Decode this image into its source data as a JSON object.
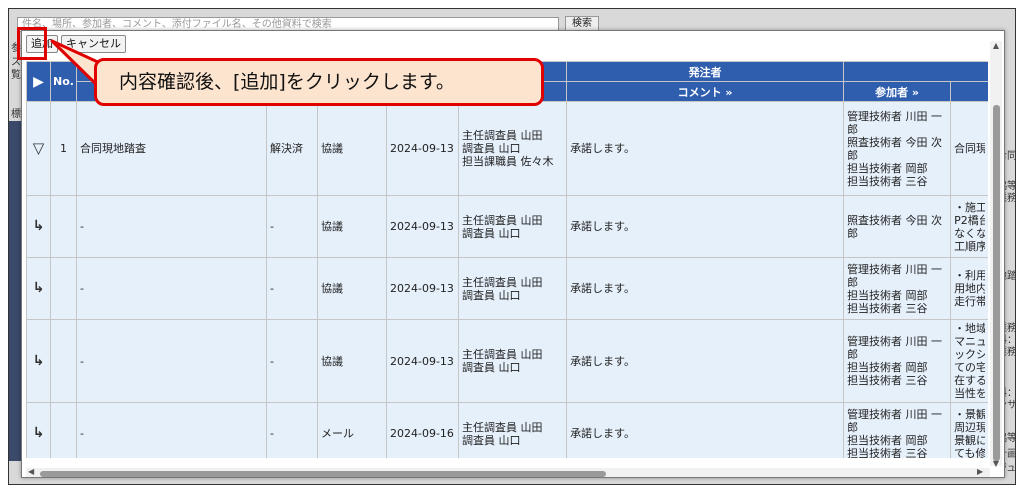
{
  "background": {
    "search_placeholder": "件名、場所、参加者、コメント、添付ファイル名、その他資料で検索",
    "search_button": "検索",
    "side_fragments": [
      "参",
      "ス",
      "覧",
      "標"
    ],
    "right_fragments": [
      "合同現",
      "協等共",
      "業務",
      "地踏査",
      "業務",
      "料：第",
      "業務",
      "料：自",
      "ンサル",
      "協等共",
      "計画",
      "ジュー"
    ]
  },
  "toolbar": {
    "add_label": "追加",
    "cancel_label": "キャンセル"
  },
  "callout": {
    "text": "内容確認後、[追加]をクリックします。"
  },
  "table": {
    "header_no": "No.",
    "header_client": "発注者",
    "header_comment": "コメント",
    "header_participants": "参加者",
    "link_arrow": "»",
    "rows": [
      {
        "toggle": "▽",
        "no": "1",
        "subject": "合同現地踏査",
        "status": "解決済",
        "type": "協議",
        "date": "2024-09-13",
        "client_attendees": [
          "主任調査員 山田",
          "調査員 山口",
          "担当課職員 佐々木"
        ],
        "comment": "承諾します。",
        "participants": [
          "管理技術者 川田 一",
          "郎",
          "照査技術者 今田 次",
          "郎",
          "担当技術者 岡部",
          "担当技術者 三谷"
        ],
        "detail": [
          "合同現"
        ]
      },
      {
        "toggle": "↳",
        "no": "",
        "subject": "-",
        "status": "-",
        "type": "協議",
        "date": "2024-09-13",
        "client_attendees": [
          "主任調査員 山田",
          "調査員 山口"
        ],
        "comment": "承諾します。",
        "participants": [
          "照査技術者 今田 次",
          "郎"
        ],
        "detail": [
          "・施工",
          "P2橋台",
          "なくな",
          "工順序"
        ]
      },
      {
        "toggle": "↳",
        "no": "",
        "subject": "-",
        "status": "-",
        "type": "協議",
        "date": "2024-09-13",
        "client_attendees": [
          "主任調査員 山田",
          "調査員 山口"
        ],
        "comment": "承諾します。",
        "participants": [
          "管理技術者 川田 一",
          "郎",
          "担当技術者 岡部",
          "担当技術者 三谷"
        ],
        "detail": [
          "・利用",
          "用地内",
          "走行帯"
        ]
      },
      {
        "toggle": "↳",
        "no": "",
        "subject": "-",
        "status": "-",
        "type": "協議",
        "date": "2024-09-13",
        "client_attendees": [
          "主任調査員 山田",
          "調査員 山口"
        ],
        "comment": "承諾します。",
        "participants": [
          "管理技術者 川田 一",
          "郎",
          "担当技術者 岡部",
          "担当技術者 三谷"
        ],
        "detail": [
          "・地域",
          "マニュア",
          "ックシ",
          "ての宅",
          "在する",
          "当性を"
        ]
      },
      {
        "toggle": "↳",
        "no": "",
        "subject": "-",
        "status": "-",
        "type": "メール",
        "date": "2024-09-16",
        "client_attendees": [
          "主任調査員 山田",
          "調査員 山口"
        ],
        "comment": "承諾します。",
        "participants": [
          "管理技術者 川田 一",
          "郎",
          "担当技術者 岡部",
          "担当技術者 三谷"
        ],
        "detail": [
          "・景観",
          "周辺現",
          "景観に",
          "ても修"
        ]
      }
    ]
  },
  "colors": {
    "header_blue": "#2f5eaf",
    "row_bg": "#e6f0fb",
    "highlight_red": "#e00000",
    "callout_bg": "#fce4cf"
  }
}
